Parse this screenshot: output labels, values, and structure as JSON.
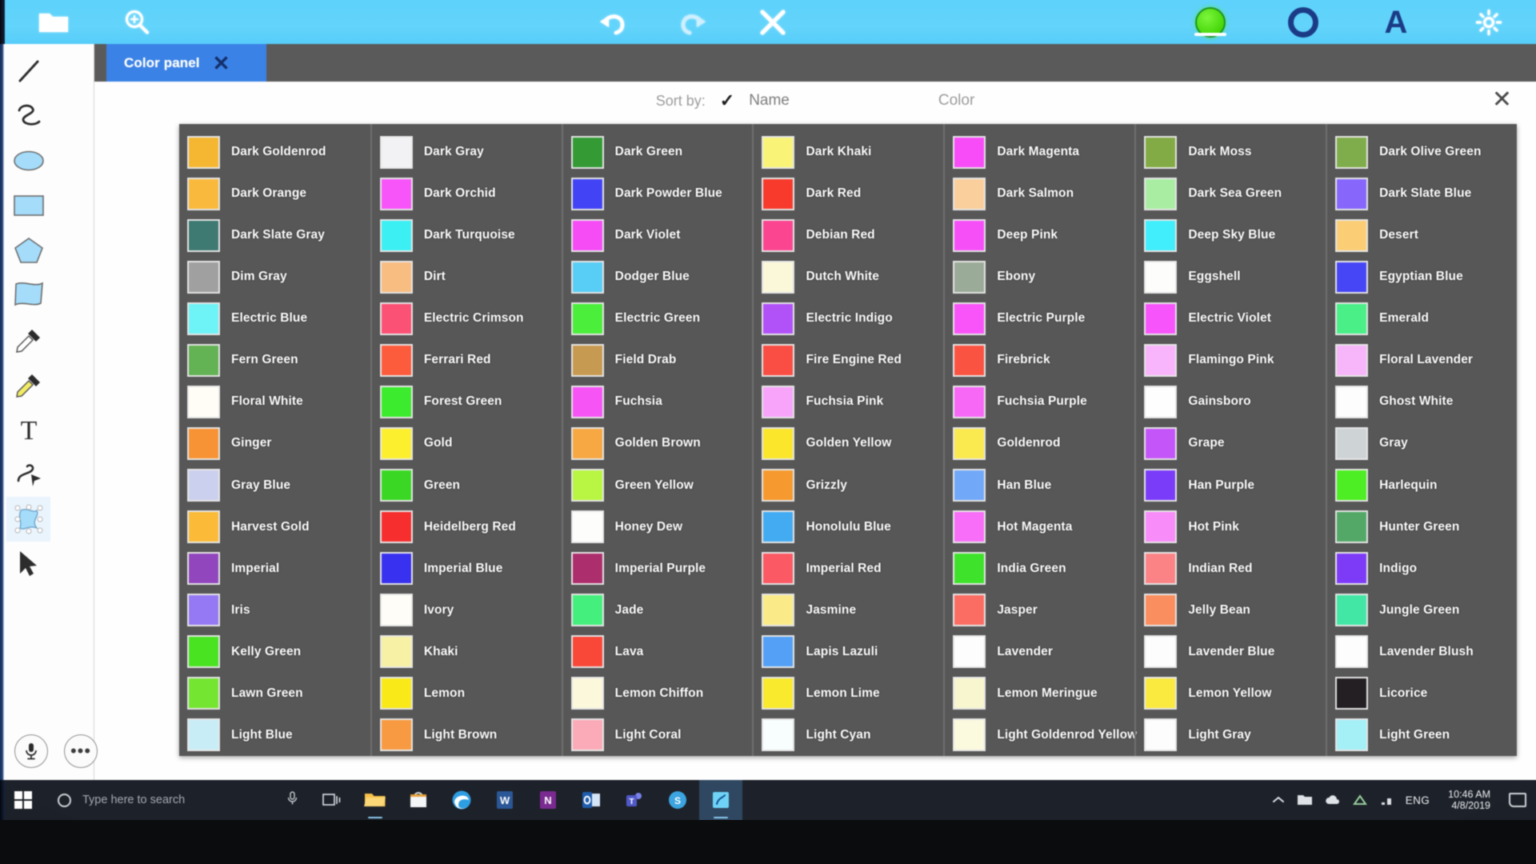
{
  "app": {
    "toolbar": {
      "left_icons": [
        {
          "name": "open-folder-icon",
          "label": "Open"
        },
        {
          "name": "zoom-in-icon",
          "label": "Zoom"
        }
      ],
      "center_icons": [
        {
          "name": "undo-icon",
          "label": "Undo"
        },
        {
          "name": "redo-icon",
          "label": "Redo"
        },
        {
          "name": "close-icon",
          "label": "Close"
        }
      ],
      "right_icons": [
        {
          "name": "fill-color-icon",
          "label": "Fill color"
        },
        {
          "name": "stroke-color-icon",
          "label": "Stroke color"
        },
        {
          "name": "text-color-icon",
          "label": "Text color"
        },
        {
          "name": "settings-gear-icon",
          "label": "Settings"
        }
      ],
      "accent_color": "#5ed2fb",
      "selected_fill_color": "#4fe017"
    },
    "tools": [
      {
        "name": "line-tool",
        "label": "Line"
      },
      {
        "name": "freehand-tool",
        "label": "Freehand"
      },
      {
        "name": "ellipse-tool",
        "label": "Ellipse"
      },
      {
        "name": "rectangle-tool",
        "label": "Rectangle"
      },
      {
        "name": "polygon-tool",
        "label": "Polygon"
      },
      {
        "name": "star-banner-tool",
        "label": "Banner"
      },
      {
        "name": "eyedropper-tool",
        "label": "Eyedropper"
      },
      {
        "name": "eyedropper-fill-tool",
        "label": "Eyedropper fill"
      },
      {
        "name": "text-tool",
        "label": "Text"
      },
      {
        "name": "node-edit-tool",
        "label": "Node edit"
      },
      {
        "name": "transform-tool",
        "label": "Transform"
      },
      {
        "name": "select-tool",
        "label": "Select"
      }
    ],
    "bottom_buttons": [
      {
        "name": "microphone-button",
        "label": "Microphone"
      },
      {
        "name": "more-options-button",
        "label": "More"
      }
    ]
  },
  "tab": {
    "label": "Color panel",
    "close_label": "✕"
  },
  "panel": {
    "sort_label": "Sort by:",
    "sort_options": [
      {
        "label": "Name",
        "checked": true
      },
      {
        "label": "Color",
        "checked": false
      }
    ],
    "check_glyph": "✓",
    "close_glyph": "✕"
  },
  "colors": {
    "columns": [
      [
        {
          "name": "Dark Goldenrod",
          "hex": "#f5b731"
        },
        {
          "name": "Dark Orange",
          "hex": "#f9b93c"
        },
        {
          "name": "Dark Slate Gray",
          "hex": "#3e7a72"
        },
        {
          "name": "Dim Gray",
          "hex": "#a0a0a0"
        },
        {
          "name": "Electric Blue",
          "hex": "#6ef3f6"
        },
        {
          "name": "Fern Green",
          "hex": "#63b254"
        },
        {
          "name": "Floral White",
          "hex": "#fffdf5"
        },
        {
          "name": "Ginger",
          "hex": "#f79334"
        },
        {
          "name": "Gray Blue",
          "hex": "#ccd0ef"
        },
        {
          "name": "Harvest Gold",
          "hex": "#fbbb39"
        },
        {
          "name": "Imperial",
          "hex": "#9146bd"
        },
        {
          "name": "Iris",
          "hex": "#9478f4"
        },
        {
          "name": "Kelly Green",
          "hex": "#4ae321"
        },
        {
          "name": "Lawn Green",
          "hex": "#74e531"
        },
        {
          "name": "Light Blue",
          "hex": "#c9edf7"
        }
      ],
      [
        {
          "name": "Dark Gray",
          "hex": "#f2f2f4"
        },
        {
          "name": "Dark Orchid",
          "hex": "#f754f9"
        },
        {
          "name": "Dark Turquoise",
          "hex": "#3ceff3"
        },
        {
          "name": "Dirt",
          "hex": "#f8bd80"
        },
        {
          "name": "Electric Crimson",
          "hex": "#fb5174"
        },
        {
          "name": "Ferrari Red",
          "hex": "#fc5b3c"
        },
        {
          "name": "Forest Green",
          "hex": "#3ceb2e"
        },
        {
          "name": "Gold",
          "hex": "#fcef2e"
        },
        {
          "name": "Green",
          "hex": "#3ad824"
        },
        {
          "name": "Heidelberg Red",
          "hex": "#f62f2e"
        },
        {
          "name": "Imperial Blue",
          "hex": "#3831ef"
        },
        {
          "name": "Ivory",
          "hex": "#fefdf7"
        },
        {
          "name": "Khaki",
          "hex": "#f7f1a5"
        },
        {
          "name": "Lemon",
          "hex": "#fae918"
        },
        {
          "name": "Light Brown",
          "hex": "#f79a41"
        }
      ],
      [
        {
          "name": "Dark Green",
          "hex": "#339a34"
        },
        {
          "name": "Dark Powder Blue",
          "hex": "#4243f5"
        },
        {
          "name": "Dark Violet",
          "hex": "#f64cf6"
        },
        {
          "name": "Dodger Blue",
          "hex": "#58cdf5"
        },
        {
          "name": "Electric Green",
          "hex": "#4bee3b"
        },
        {
          "name": "Field Drab",
          "hex": "#c79a52"
        },
        {
          "name": "Fuchsia",
          "hex": "#f754f6"
        },
        {
          "name": "Golden Brown",
          "hex": "#f8a843"
        },
        {
          "name": "Green Yellow",
          "hex": "#b9f644"
        },
        {
          "name": "Honey Dew",
          "hex": "#fdfefc"
        },
        {
          "name": "Imperial Purple",
          "hex": "#ad2e6c"
        },
        {
          "name": "Jade",
          "hex": "#45ef7d"
        },
        {
          "name": "Lava",
          "hex": "#f94738"
        },
        {
          "name": "Lemon Chiffon",
          "hex": "#fbf8dc"
        },
        {
          "name": "Light Coral",
          "hex": "#fbabb8"
        }
      ],
      [
        {
          "name": "Dark Khaki",
          "hex": "#f9f478"
        },
        {
          "name": "Dark Red",
          "hex": "#f73a2c"
        },
        {
          "name": "Debian Red",
          "hex": "#fb4590"
        },
        {
          "name": "Dutch White",
          "hex": "#fbf8d9"
        },
        {
          "name": "Electric Indigo",
          "hex": "#b151f8"
        },
        {
          "name": "Fire Engine Red",
          "hex": "#fa4d43"
        },
        {
          "name": "Fuchsia Pink",
          "hex": "#f8a4fa"
        },
        {
          "name": "Golden Yellow",
          "hex": "#fbe62b"
        },
        {
          "name": "Grizzly",
          "hex": "#f6992e"
        },
        {
          "name": "Honolulu Blue",
          "hex": "#43abf1"
        },
        {
          "name": "Imperial Red",
          "hex": "#fb5963"
        },
        {
          "name": "Jasmine",
          "hex": "#fbeb88"
        },
        {
          "name": "Lapis Lazuli",
          "hex": "#53a0f6"
        },
        {
          "name": "Lemon Lime",
          "hex": "#f9ea2e"
        },
        {
          "name": "Light Cyan",
          "hex": "#f8fdfd"
        }
      ],
      [
        {
          "name": "Dark Magenta",
          "hex": "#f74cf8"
        },
        {
          "name": "Dark Salmon",
          "hex": "#fbcf9c"
        },
        {
          "name": "Deep Pink",
          "hex": "#f74ff8"
        },
        {
          "name": "Ebony",
          "hex": "#9aab97"
        },
        {
          "name": "Electric Purple",
          "hex": "#f954f9"
        },
        {
          "name": "Firebrick",
          "hex": "#fa5341"
        },
        {
          "name": "Fuchsia Purple",
          "hex": "#f868f6"
        },
        {
          "name": "Goldenrod",
          "hex": "#fbe950"
        },
        {
          "name": "Han Blue",
          "hex": "#72a8f8"
        },
        {
          "name": "Hot Magenta",
          "hex": "#f86ef8"
        },
        {
          "name": "India Green",
          "hex": "#3fe22b"
        },
        {
          "name": "Jasper",
          "hex": "#fb6c63"
        },
        {
          "name": "Lavender",
          "hex": "#fefdfd"
        },
        {
          "name": "Lemon Meringue",
          "hex": "#f8f6cf"
        },
        {
          "name": "Light Goldenrod Yellow",
          "hex": "#fbfade"
        }
      ],
      [
        {
          "name": "Dark Moss",
          "hex": "#83ab45"
        },
        {
          "name": "Dark Sea Green",
          "hex": "#a9eda3"
        },
        {
          "name": "Deep Sky Blue",
          "hex": "#41eefb"
        },
        {
          "name": "Eggshell",
          "hex": "#fdfdfb"
        },
        {
          "name": "Electric Violet",
          "hex": "#f755fb"
        },
        {
          "name": "Flamingo Pink",
          "hex": "#f8b5fb"
        },
        {
          "name": "Gainsboro",
          "hex": "#fefefe"
        },
        {
          "name": "Grape",
          "hex": "#c455f8"
        },
        {
          "name": "Han Purple",
          "hex": "#7a3cf9"
        },
        {
          "name": "Hot Pink",
          "hex": "#f88cf9"
        },
        {
          "name": "Indian Red",
          "hex": "#fb8385"
        },
        {
          "name": "Jelly Bean",
          "hex": "#fa8e5e"
        },
        {
          "name": "Lavender Blue",
          "hex": "#fdfdfe"
        },
        {
          "name": "Lemon Yellow",
          "hex": "#fae93f"
        },
        {
          "name": "Light Gray",
          "hex": "#fdfdfd"
        }
      ],
      [
        {
          "name": "Dark Olive Green",
          "hex": "#80ad4b"
        },
        {
          "name": "Dark Slate Blue",
          "hex": "#8767fb"
        },
        {
          "name": "Desert",
          "hex": "#fbce76"
        },
        {
          "name": "Egyptian Blue",
          "hex": "#4746f6"
        },
        {
          "name": "Emerald",
          "hex": "#4aef88"
        },
        {
          "name": "Floral Lavender",
          "hex": "#f8b6fa"
        },
        {
          "name": "Ghost White",
          "hex": "#fdfdfe"
        },
        {
          "name": "Gray",
          "hex": "#ced3d6"
        },
        {
          "name": "Harlequin",
          "hex": "#4eee24"
        },
        {
          "name": "Hunter Green",
          "hex": "#53a868"
        },
        {
          "name": "Indigo",
          "hex": "#7d3bf8"
        },
        {
          "name": "Jungle Green",
          "hex": "#42e7a5"
        },
        {
          "name": "Lavender Blush",
          "hex": "#fefdfe"
        },
        {
          "name": "Licorice",
          "hex": "#241f23"
        },
        {
          "name": "Light Green",
          "hex": "#a5eff6"
        }
      ]
    ]
  },
  "taskbar": {
    "search_placeholder": "Type here to search",
    "language": "ENG",
    "time": "10:46 AM",
    "date": "4/8/2019",
    "apps": [
      {
        "name": "task-view-button",
        "label": "Task View"
      },
      {
        "name": "file-explorer-button",
        "label": "File Explorer"
      },
      {
        "name": "store-button",
        "label": "Microsoft Store"
      },
      {
        "name": "edge-button",
        "label": "Microsoft Edge"
      },
      {
        "name": "word-button",
        "label": "Word"
      },
      {
        "name": "onenote-button",
        "label": "OneNote"
      },
      {
        "name": "outlook-button",
        "label": "Outlook"
      },
      {
        "name": "teams-button",
        "label": "Teams"
      },
      {
        "name": "skype-button",
        "label": "Skype"
      },
      {
        "name": "drawing-app-button",
        "label": "Drawing App"
      }
    ]
  }
}
